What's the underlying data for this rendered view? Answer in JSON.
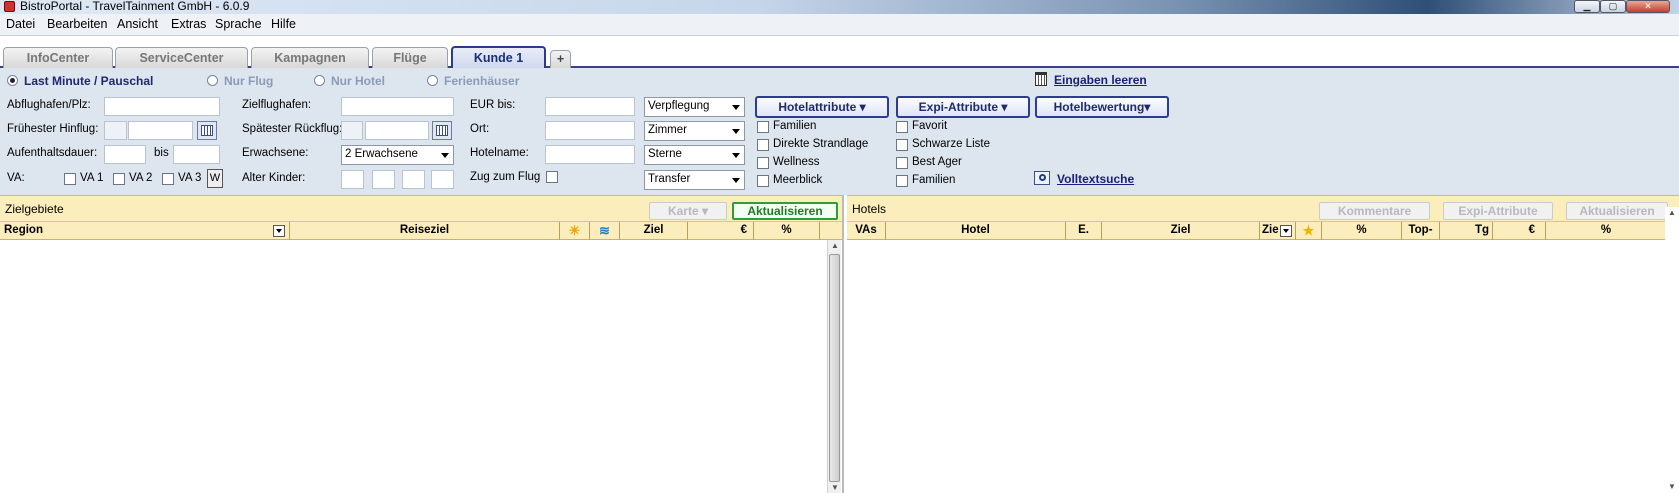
{
  "window": {
    "title": "BistroPortal - TravelTainment GmbH - 6.0.9"
  },
  "menu": [
    "Datei",
    "Bearbeiten",
    "Ansicht",
    "Extras",
    "Sprache",
    "Hilfe"
  ],
  "tabs": [
    "InfoCenter",
    "ServiceCenter",
    "Kampagnen",
    "Flüge",
    "Kunde 1"
  ],
  "radios": [
    "Last Minute / Pauschal",
    "Nur Flug",
    "Nur Hotel",
    "Ferienhäuser"
  ],
  "clear_link": "Eingaben leeren",
  "fields": {
    "abflughafen": "Abflughafen/Plz:",
    "fruehester": "Frühester Hinflug:",
    "aufenthalt": "Aufenthaltsdauer:",
    "bis": "bis",
    "va": "VA:",
    "va1": "VA 1",
    "va2": "VA 2",
    "va3": "VA 3",
    "w": "W",
    "zielflughafen": "Zielflughafen:",
    "spaetester": "Spätester Rückflug:",
    "erwachsene": "Erwachsene:",
    "erwachsene_val": "2 Erwachsene",
    "alter_kinder": "Alter Kinder:",
    "eur_bis": "EUR bis:",
    "ort": "Ort:",
    "hotelname": "Hotelname:",
    "zug": "Zug zum Flug"
  },
  "dropdowns": [
    "Verpflegung",
    "Zimmer",
    "Sterne",
    "Transfer"
  ],
  "attr_buttons": [
    "Hotelattribute ▾",
    "Expi-Attribute ▾",
    "Hotelbewertung▾"
  ],
  "hotel_checks": [
    "Familien",
    "Direkte Strandlage",
    "Wellness",
    "Meerblick"
  ],
  "expi_checks": [
    "Favorit",
    "Schwarze Liste",
    "Best Ager",
    "Familien"
  ],
  "fulltext": "Volltextsuche",
  "left_panel": {
    "title": "Zielgebiete",
    "karte": "Karte ▾",
    "aktualisieren": "Aktualisieren",
    "columns": [
      "Region",
      "Reiseziel",
      "",
      "",
      "Ziel",
      "€",
      "%"
    ]
  },
  "right_panel": {
    "title": "Hotels",
    "kommentare": "Kommentare",
    "expi": "Expi-Attribute",
    "aktualisieren": "Aktualisieren",
    "columns": [
      "VAs",
      "Hotel",
      "E.",
      "Ziel",
      "Zie",
      "",
      "%",
      "Top-",
      "Tg",
      "€",
      "%"
    ]
  }
}
